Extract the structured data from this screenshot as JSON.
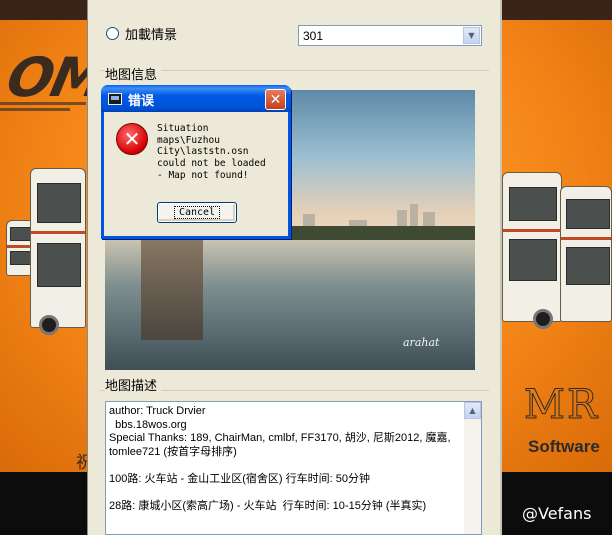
{
  "options": {
    "load_scene_label": "加載情景",
    "scene_select_value": "301"
  },
  "map_info": {
    "title": "地图信息",
    "photo_signature": "arahat"
  },
  "map_description": {
    "title": "地图描述",
    "text": "author: Truck Drvier\n  bbs.18wos.org\nSpecial Thanks: 189, ChairMan, cmlbf, FF3170, 胡沙, 尼斯2012, 魔嘉, tomlee721 (按首字母排序)\n\n100路: 火车站 - 金山工业区(宿舍区) 行车时间: 50分钟\n\n28路: 康城小区(索高广场) - 火车站  行车时间: 10-15分钟 (半真实)"
  },
  "error_dialog": {
    "title": "错误",
    "message": "Situation\nmaps\\Fuzhou\nCity\\laststn.osn\ncould not be loaded\n- Map not found!",
    "cancel_label": "Cancel",
    "close_glyph": "✕",
    "icon": "error-x-icon"
  },
  "background": {
    "logo_text": "OM",
    "brand_letters": "MR",
    "brand_sub": "Software",
    "bottom_glyph": "祝",
    "watermark": "@Vefans"
  },
  "colors": {
    "accent_titlebar": "#0054e3",
    "splash_orange": "#f6881a",
    "error_red": "#d40000"
  }
}
